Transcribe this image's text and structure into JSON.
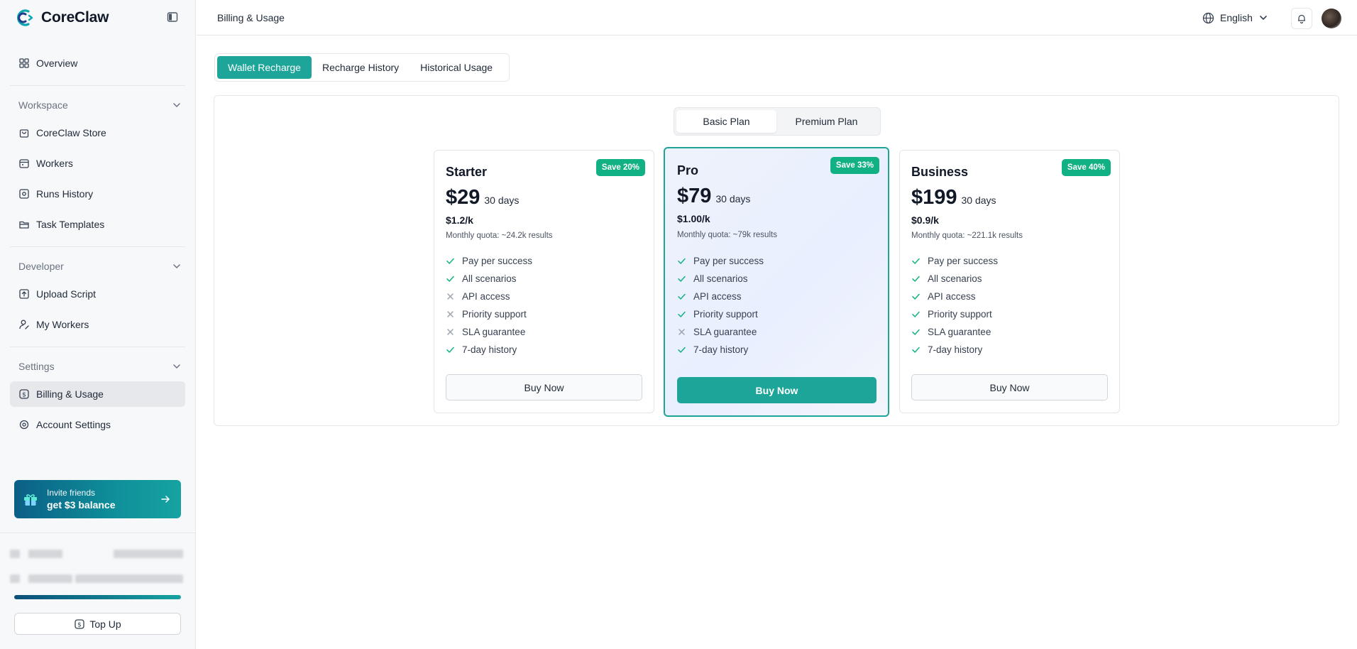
{
  "brand": {
    "name": "CoreClaw"
  },
  "header": {
    "page_title": "Billing & Usage",
    "language": "English"
  },
  "sidebar": {
    "overview": "Overview",
    "workspace": {
      "label": "Workspace",
      "items": [
        "CoreClaw Store",
        "Workers",
        "Runs History",
        "Task Templates"
      ]
    },
    "developer": {
      "label": "Developer",
      "items": [
        "Upload Script",
        "My Workers"
      ]
    },
    "settings": {
      "label": "Settings",
      "items": [
        "Billing & Usage",
        "Account Settings"
      ]
    },
    "invite": {
      "line1": "Invite friends",
      "line2": "get $3 balance"
    },
    "top_up": "Top Up"
  },
  "tabs": [
    "Wallet Recharge",
    "Recharge History",
    "Historical Usage"
  ],
  "plan_toggle": [
    "Basic Plan",
    "Premium Plan"
  ],
  "plans": [
    {
      "name": "Starter",
      "badge": "Save 20%",
      "price": "$29",
      "period": "30 days",
      "rate": "$1.2/k",
      "quota": "Monthly quota: ~24.2k results",
      "features": [
        {
          "label": "Pay per success",
          "included": true
        },
        {
          "label": "All scenarios",
          "included": true
        },
        {
          "label": "API access",
          "included": false
        },
        {
          "label": "Priority support",
          "included": false
        },
        {
          "label": "SLA guarantee",
          "included": false
        },
        {
          "label": "7-day history",
          "included": true
        }
      ],
      "button": "Buy Now"
    },
    {
      "name": "Pro",
      "badge": "Save 33%",
      "price": "$79",
      "period": "30 days",
      "rate": "$1.00/k",
      "quota": "Monthly quota: ~79k results",
      "features": [
        {
          "label": "Pay per success",
          "included": true
        },
        {
          "label": "All scenarios",
          "included": true
        },
        {
          "label": "API access",
          "included": true
        },
        {
          "label": "Priority support",
          "included": true
        },
        {
          "label": "SLA guarantee",
          "included": false
        },
        {
          "label": "7-day history",
          "included": true
        }
      ],
      "button": "Buy Now"
    },
    {
      "name": "Business",
      "badge": "Save 40%",
      "price": "$199",
      "period": "30 days",
      "rate": "$0.9/k",
      "quota": "Monthly quota: ~221.1k results",
      "features": [
        {
          "label": "Pay per success",
          "included": true
        },
        {
          "label": "All scenarios",
          "included": true
        },
        {
          "label": "API access",
          "included": true
        },
        {
          "label": "Priority support",
          "included": true
        },
        {
          "label": "SLA guarantee",
          "included": true
        },
        {
          "label": "7-day history",
          "included": true
        }
      ],
      "button": "Buy Now"
    }
  ],
  "colors": {
    "accent": "#1ea59a",
    "badge": "#12b183",
    "check": "#12b183",
    "cross": "#9ca3af"
  }
}
